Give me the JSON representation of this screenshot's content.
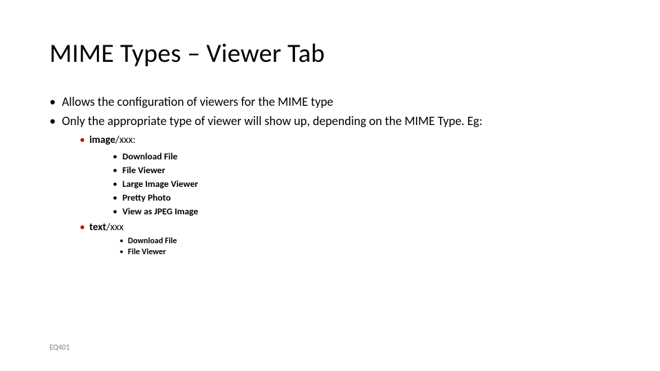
{
  "title": "MIME Types – Viewer Tab",
  "bullets": {
    "b1": "Allows the configuration of viewers for the MIME type",
    "b2": "Only the appropriate type of viewer will show up, depending on the MIME Type.  Eg:",
    "sub1_bold": "image",
    "sub1_rest": "/xxx:",
    "sub1_items": {
      "i1": "Download File",
      "i2": "File Viewer",
      "i3": "Large Image Viewer",
      "i4": "Pretty Photo",
      "i5": "View as JPEG Image"
    },
    "sub2_bold": "text",
    "sub2_rest": "/xxx",
    "sub2_items": {
      "i1": "Download File",
      "i2": "File Viewer"
    }
  },
  "footer": "EQ401"
}
